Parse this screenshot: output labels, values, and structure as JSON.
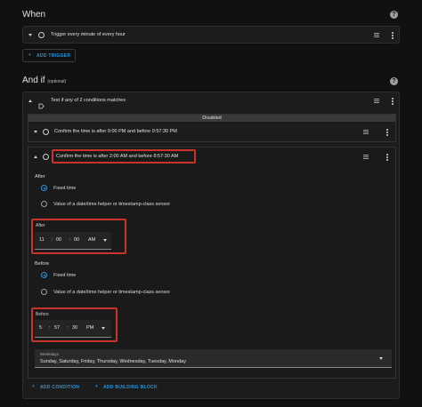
{
  "when": {
    "title": "When",
    "trigger": {
      "label": "Trigger every minute of every hour"
    },
    "add_trigger_label": "ADD TRIGGER"
  },
  "and_if": {
    "title": "And if",
    "subtitle": "(optional)",
    "or_condition": {
      "label": "Test if any of 2 conditions matches"
    },
    "disabled_label": "Disabled",
    "condition_1": {
      "label": "Confirm the time is after 9:00 PM and before 9:57:30 PM"
    },
    "condition_2": {
      "label": "Confirm the time is after 2:00 AM and before 8:57:30 AM",
      "after": {
        "section_label": "After",
        "option_fixed": "Fixed time",
        "option_helper": "Value of a date/time helper or timestamp-class sensor",
        "field_label": "After",
        "hour": "11",
        "minute": "00",
        "second": "00",
        "ampm": "AM"
      },
      "before": {
        "section_label": "Before",
        "option_fixed": "Fixed time",
        "option_helper": "Value of a date/time helper or timestamp-class sensor",
        "field_label": "Before",
        "hour": "5",
        "minute": "57",
        "second": "30",
        "ampm": "PM"
      },
      "weekdays": {
        "label": "Weekdays",
        "value": "Sunday, Saturday, Friday, Thursday, Wednesday, Tuesday, Monday"
      }
    },
    "add_condition_label": "ADD CONDITION",
    "add_building_block_label": "ADD BUILDING BLOCK"
  },
  "colors": {
    "accent": "#2e94d8",
    "highlight": "#c8332b",
    "background": "#111111"
  }
}
